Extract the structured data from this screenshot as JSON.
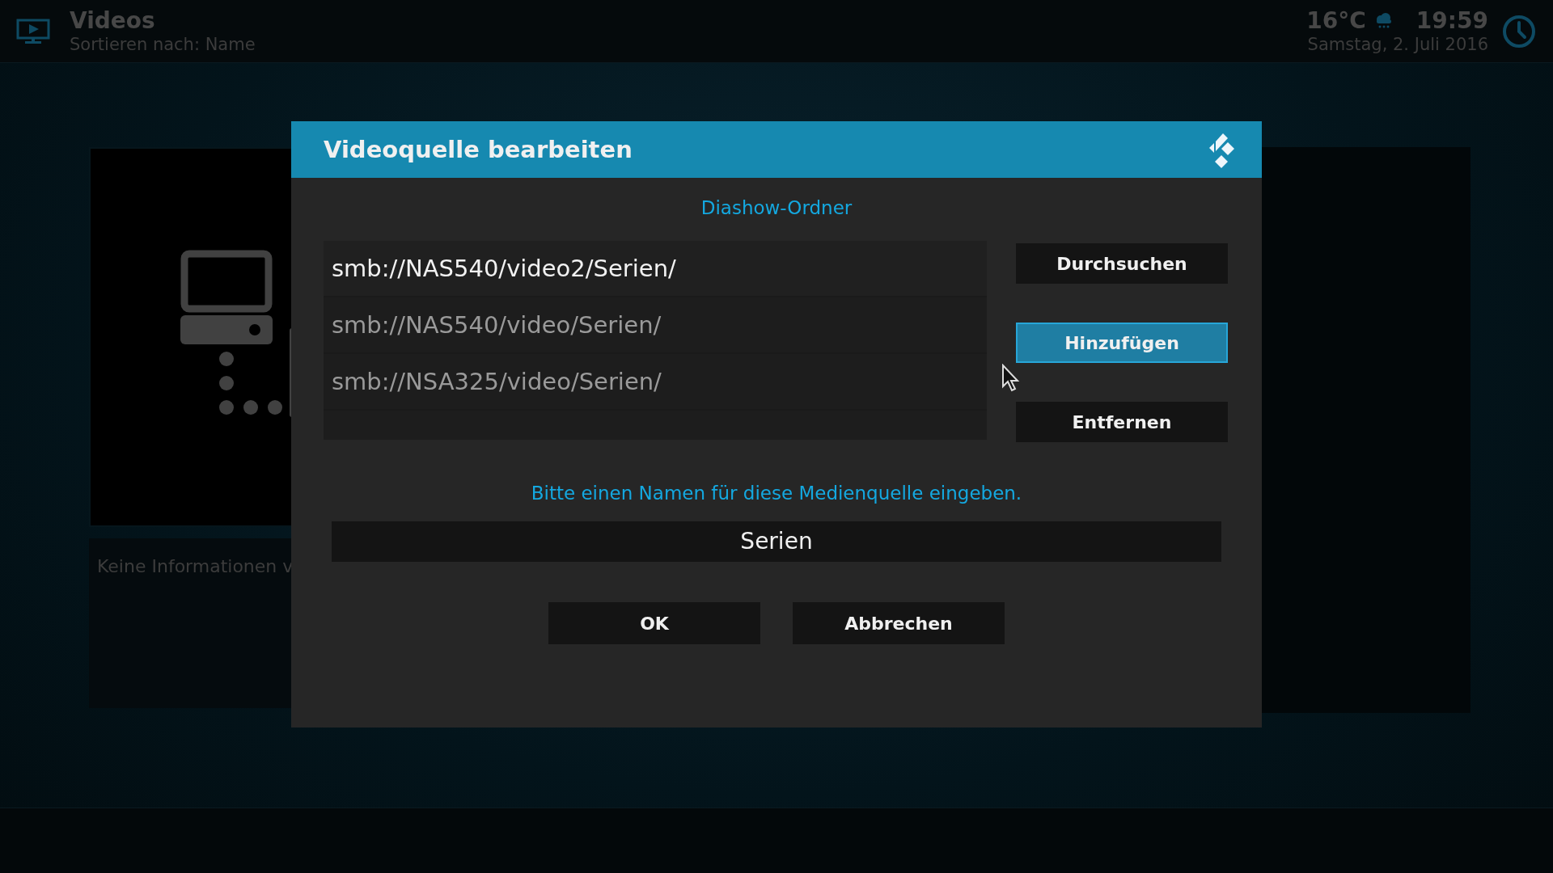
{
  "header": {
    "title": "Videos",
    "subtitle": "Sortieren nach: Name",
    "temperature": "16°C",
    "time": "19:59",
    "date": "Samstag, 2. Juli 2016"
  },
  "background": {
    "info_text": "Keine Informationen v"
  },
  "dialog": {
    "title": "Videoquelle bearbeiten",
    "section_label": "Diashow-Ordner",
    "paths": [
      {
        "text": "smb://NAS540/video2/Serien/",
        "selected": true
      },
      {
        "text": "smb://NAS540/video/Serien/",
        "selected": false
      },
      {
        "text": "smb://NSA325/video/Serien/",
        "selected": false
      }
    ],
    "side_buttons": [
      {
        "label": "Durchsuchen",
        "selected": false
      },
      {
        "label": "Hinzufügen",
        "selected": true
      },
      {
        "label": "Entfernen",
        "selected": false
      }
    ],
    "name_prompt": "Bitte einen Namen für diese Medienquelle eingeben.",
    "name_value": "Serien",
    "buttons": [
      {
        "label": "OK",
        "selected": false
      },
      {
        "label": "Abbrechen",
        "selected": false
      }
    ]
  }
}
